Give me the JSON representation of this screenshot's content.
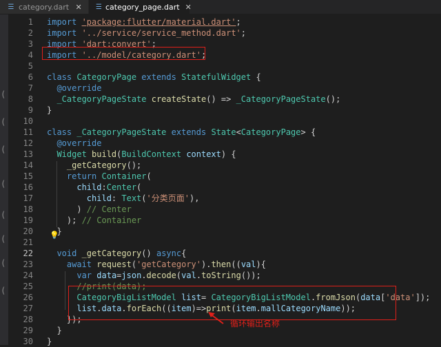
{
  "tabs": [
    {
      "label": "category.dart",
      "icon": "dart-file-icon",
      "close": "✕"
    },
    {
      "label": "category_page.dart",
      "icon": "dart-file-icon",
      "close": "✕"
    }
  ],
  "annotation": {
    "text": "循环输出名称"
  },
  "code_lines": [
    {
      "n": "1",
      "t": [
        [
          "kw",
          "import "
        ],
        [
          "str-u",
          "'package:flutter/material.dart'"
        ],
        [
          "pl",
          ";"
        ]
      ]
    },
    {
      "n": "2",
      "t": [
        [
          "kw",
          "import "
        ],
        [
          "str",
          "'../service/service_method.dart'"
        ],
        [
          "pl",
          ";"
        ]
      ]
    },
    {
      "n": "3",
      "t": [
        [
          "kw",
          "import "
        ],
        [
          "str",
          "'dart:convert'"
        ],
        [
          "pl",
          ";"
        ]
      ]
    },
    {
      "n": "4",
      "t": [
        [
          "kw",
          "import "
        ],
        [
          "str",
          "'../model/category.dart'"
        ],
        [
          "pl",
          ";"
        ]
      ]
    },
    {
      "n": "5",
      "t": []
    },
    {
      "n": "6",
      "t": [
        [
          "kw",
          "class "
        ],
        [
          "cls",
          "CategoryPage "
        ],
        [
          "kw",
          "extends "
        ],
        [
          "cls",
          "StatefulWidget "
        ],
        [
          "pl",
          "{"
        ]
      ]
    },
    {
      "n": "7",
      "t": [
        [
          "pl",
          "  "
        ],
        [
          "kw",
          "@override"
        ]
      ]
    },
    {
      "n": "8",
      "t": [
        [
          "pl",
          "  "
        ],
        [
          "cls",
          "_CategoryPageState "
        ],
        [
          "fn",
          "createState"
        ],
        [
          "pl",
          "() => "
        ],
        [
          "cls",
          "_CategoryPageState"
        ],
        [
          "pl",
          "();"
        ]
      ]
    },
    {
      "n": "9",
      "t": [
        [
          "pl",
          "}"
        ]
      ]
    },
    {
      "n": "10",
      "t": []
    },
    {
      "n": "11",
      "t": [
        [
          "kw",
          "class "
        ],
        [
          "cls",
          "_CategoryPageState "
        ],
        [
          "kw",
          "extends "
        ],
        [
          "cls",
          "State"
        ],
        [
          "pl",
          "<"
        ],
        [
          "cls",
          "CategoryPage"
        ],
        [
          "pl",
          "> {"
        ]
      ]
    },
    {
      "n": "12",
      "t": [
        [
          "pl",
          "  "
        ],
        [
          "kw",
          "@override"
        ]
      ]
    },
    {
      "n": "13",
      "t": [
        [
          "pl",
          "  "
        ],
        [
          "cls",
          "Widget "
        ],
        [
          "fn",
          "build"
        ],
        [
          "pl",
          "("
        ],
        [
          "cls",
          "BuildContext "
        ],
        [
          "var",
          "context"
        ],
        [
          "pl",
          ") {"
        ]
      ]
    },
    {
      "n": "14",
      "t": [
        [
          "pl",
          "    "
        ],
        [
          "fn",
          "_getCategory"
        ],
        [
          "pl",
          "();"
        ]
      ]
    },
    {
      "n": "15",
      "t": [
        [
          "pl",
          "    "
        ],
        [
          "kw",
          "return "
        ],
        [
          "cls",
          "Container"
        ],
        [
          "pl",
          "("
        ]
      ]
    },
    {
      "n": "16",
      "t": [
        [
          "pl",
          "      "
        ],
        [
          "var",
          "child"
        ],
        [
          "pl",
          ":"
        ],
        [
          "cls",
          "Center"
        ],
        [
          "pl",
          "("
        ]
      ]
    },
    {
      "n": "17",
      "t": [
        [
          "pl",
          "        "
        ],
        [
          "var",
          "child"
        ],
        [
          "pl",
          ": "
        ],
        [
          "cls",
          "Text"
        ],
        [
          "pl",
          "("
        ],
        [
          "str",
          "'分类页面'"
        ],
        [
          "pl",
          "),"
        ]
      ]
    },
    {
      "n": "18",
      "t": [
        [
          "pl",
          "      ) "
        ],
        [
          "cm",
          "// Center"
        ]
      ]
    },
    {
      "n": "19",
      "t": [
        [
          "pl",
          "    ); "
        ],
        [
          "cm",
          "// Container"
        ]
      ]
    },
    {
      "n": "20",
      "t": [
        [
          "pl",
          "  }"
        ]
      ]
    },
    {
      "n": "21",
      "t": []
    },
    {
      "n": "22",
      "t": [
        [
          "pl",
          "  "
        ],
        [
          "kw",
          "void "
        ],
        [
          "fn",
          "_getCategory"
        ],
        [
          "pl",
          "() "
        ],
        [
          "kw",
          "async"
        ],
        [
          "pl",
          "{"
        ]
      ]
    },
    {
      "n": "23",
      "t": [
        [
          "pl",
          "    "
        ],
        [
          "kw",
          "await "
        ],
        [
          "fn",
          "request"
        ],
        [
          "pl",
          "("
        ],
        [
          "str",
          "'getCategory'"
        ],
        [
          "pl",
          ")."
        ],
        [
          "fn",
          "then"
        ],
        [
          "pl",
          "(("
        ],
        [
          "var",
          "val"
        ],
        [
          "pl",
          ")"
        ],
        [
          "pl",
          "{"
        ]
      ]
    },
    {
      "n": "24",
      "t": [
        [
          "pl",
          "      "
        ],
        [
          "kw",
          "var "
        ],
        [
          "var",
          "data"
        ],
        [
          "pl",
          "="
        ],
        [
          "var",
          "json"
        ],
        [
          "pl",
          "."
        ],
        [
          "fn",
          "decode"
        ],
        [
          "pl",
          "("
        ],
        [
          "var",
          "val"
        ],
        [
          "pl",
          "."
        ],
        [
          "fn",
          "toString"
        ],
        [
          "pl",
          "());"
        ]
      ]
    },
    {
      "n": "25",
      "t": [
        [
          "pl",
          "      "
        ],
        [
          "cm",
          "//print(data);"
        ]
      ]
    },
    {
      "n": "26",
      "t": [
        [
          "pl",
          "      "
        ],
        [
          "cls",
          "CategoryBigListModel "
        ],
        [
          "var",
          "list"
        ],
        [
          "pl",
          "= "
        ],
        [
          "cls",
          "CategoryBigListModel"
        ],
        [
          "pl",
          "."
        ],
        [
          "fn",
          "fromJson"
        ],
        [
          "pl",
          "("
        ],
        [
          "var",
          "data"
        ],
        [
          "pl",
          "["
        ],
        [
          "str",
          "'data'"
        ],
        [
          "pl",
          "]);"
        ]
      ]
    },
    {
      "n": "27",
      "t": [
        [
          "pl",
          "      "
        ],
        [
          "var",
          "list"
        ],
        [
          "pl",
          "."
        ],
        [
          "var",
          "data"
        ],
        [
          "pl",
          "."
        ],
        [
          "fn",
          "forEach"
        ],
        [
          "pl",
          "(("
        ],
        [
          "var",
          "item"
        ],
        [
          "pl",
          ")=>"
        ],
        [
          "fn",
          "print"
        ],
        [
          "pl",
          "("
        ],
        [
          "var",
          "item"
        ],
        [
          "pl",
          "."
        ],
        [
          "var",
          "mallCategoryName"
        ],
        [
          "pl",
          "));"
        ]
      ]
    },
    {
      "n": "28",
      "t": [
        [
          "pl",
          "    });"
        ]
      ]
    },
    {
      "n": "29",
      "t": [
        [
          "pl",
          "  }"
        ]
      ]
    },
    {
      "n": "30",
      "t": [
        [
          "pl",
          "}"
        ]
      ]
    }
  ],
  "current_line": "22"
}
